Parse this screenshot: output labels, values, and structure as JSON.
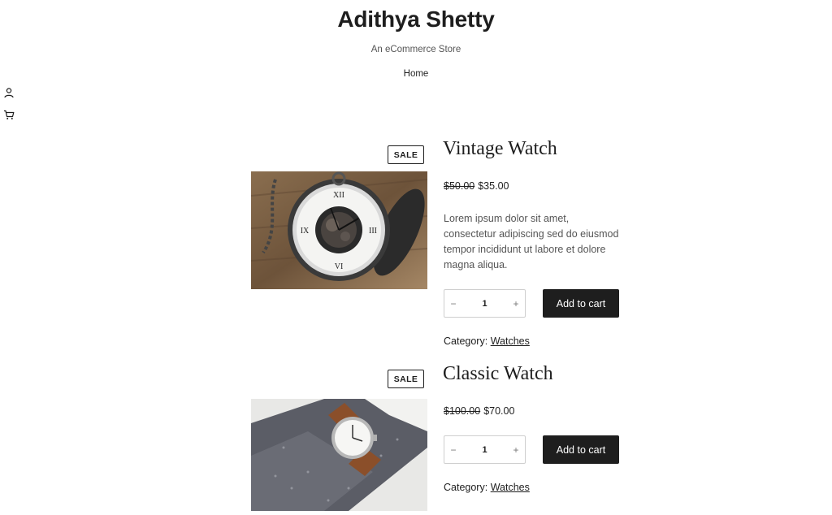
{
  "site": {
    "title": "Adithya Shetty",
    "tagline": "An eCommerce Store",
    "nav": [
      "Home"
    ]
  },
  "side_icons": [
    "account-icon",
    "cart-icon"
  ],
  "products": [
    {
      "sale_badge": "SALE",
      "title": "Vintage Watch",
      "old_price": "$50.00",
      "price": "$35.00",
      "description": "Lorem ipsum dolor sit amet, consectetur adipiscing sed do eiusmod tempor incididunt ut labore et dolore magna aliqua.",
      "quantity": "1",
      "qty_minus": "−",
      "qty_plus": "+",
      "add_to_cart": "Add to cart",
      "category_label": "Category:",
      "category": "Watches",
      "image": "pocket-watch-photo"
    },
    {
      "sale_badge": "SALE",
      "title": "Classic Watch",
      "old_price": "$100.00",
      "price": "$70.00",
      "quantity": "1",
      "qty_minus": "−",
      "qty_plus": "+",
      "add_to_cart": "Add to cart",
      "category_label": "Category:",
      "category": "Watches",
      "image": "wrist-watch-photo"
    }
  ],
  "colors": {
    "text": "#1e1e1e",
    "muted": "#555555",
    "button_bg": "#1e1e1e",
    "button_text": "#ffffff"
  }
}
